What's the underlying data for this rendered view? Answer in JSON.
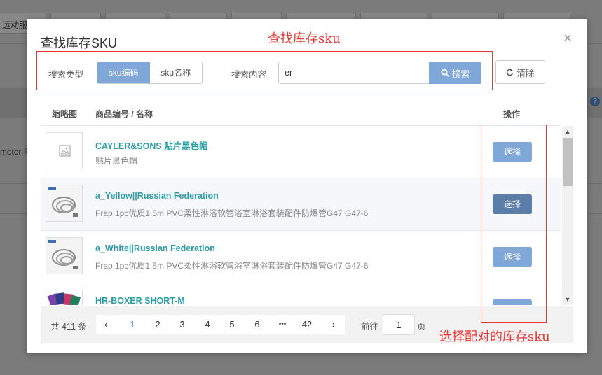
{
  "background": {
    "tab_label": "运动服",
    "left_text": "motor R",
    "help_icon": "?"
  },
  "modal": {
    "title": "查找库存SKU",
    "close_icon": "×"
  },
  "annotations": {
    "top": "查找库存sku",
    "bottom": "选择配对的库存sku",
    "color": "#e53935"
  },
  "search": {
    "type_label": "搜索类型",
    "type_options": [
      "sku编码",
      "sku名称"
    ],
    "content_label": "搜索内容",
    "query": "er",
    "search_button": "搜索",
    "clear_button": "清除",
    "accent_color": "#7fa7d8"
  },
  "table": {
    "headers": {
      "thumb": "缩略图",
      "product": "商品编号 / 名称",
      "action": "操作"
    },
    "rows": [
      {
        "code": "CAYLER&SONS 贴片黑色帽",
        "name": "贴片黑色帽",
        "thumb_icon": "image-placeholder-icon",
        "button": "选择"
      },
      {
        "code": "a_Yellow||Russian Federation",
        "name": "Frap 1pc优质1.5m PVC柔性淋浴软管浴室淋浴套装配件防爆管G47 G47-6",
        "thumb_icon": "shower-hose-icon",
        "button": "选择"
      },
      {
        "code": "a_White||Russian Federation",
        "name": "Frap 1pc优质1.5m PVC柔性淋浴软管浴室淋浴套装配件防爆管G47 G47-6",
        "thumb_icon": "shower-hose-icon",
        "button": "选择"
      },
      {
        "code": "HR-BOXER SHORT-M",
        "name": "",
        "thumb_icon": "boxer-shorts-icon",
        "button": "选择"
      }
    ]
  },
  "pagination": {
    "total": "共 411 条",
    "prev_icon": "‹",
    "next_icon": "›",
    "pages": [
      "1",
      "2",
      "3",
      "4",
      "5",
      "6",
      "•••",
      "42"
    ],
    "current_page": "1",
    "goto_label": "前往",
    "goto_value": "1",
    "goto_suffix": "页"
  }
}
